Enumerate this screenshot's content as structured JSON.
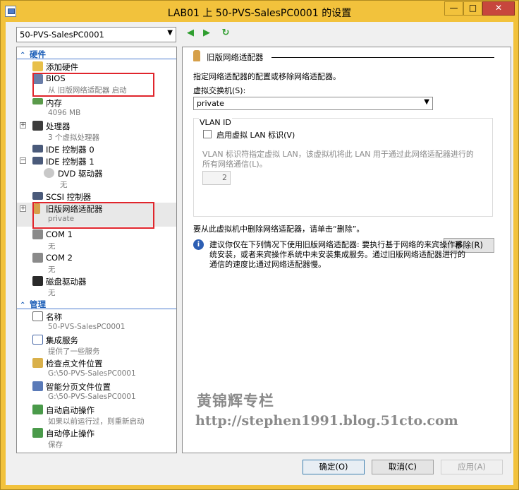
{
  "window": {
    "title": "LAB01 上 50-PVS-SalesPC0001 的设置",
    "min_glyph": "—",
    "max_glyph": "□",
    "close_glyph": "✕"
  },
  "vm_selector": {
    "value": "50-PVS-SalesPC0001"
  },
  "tree": {
    "hardware_header": "硬件",
    "management_header": "管理",
    "hardware_items": [
      {
        "label": "添加硬件",
        "sub": "",
        "icon": "add-hardware-icon"
      },
      {
        "label": "BIOS",
        "sub": "从 旧版网络适配器 启动",
        "icon": "bios-icon"
      },
      {
        "label": "内存",
        "sub": "4096 MB",
        "icon": "memory-icon"
      },
      {
        "label": "处理器",
        "sub": "3 个虚拟处理器",
        "icon": "processor-icon"
      },
      {
        "label": "IDE 控制器 0",
        "sub": "",
        "icon": "ide-controller-icon"
      },
      {
        "label": "IDE 控制器 1",
        "sub": "",
        "icon": "ide-controller-icon"
      },
      {
        "label": "DVD 驱动器",
        "sub": "无",
        "icon": "dvd-drive-icon"
      },
      {
        "label": "SCSI 控制器",
        "sub": "",
        "icon": "scsi-controller-icon"
      },
      {
        "label": "旧版网络适配器",
        "sub": "private",
        "icon": "network-adapter-icon"
      },
      {
        "label": "COM 1",
        "sub": "无",
        "icon": "com-port-icon"
      },
      {
        "label": "COM 2",
        "sub": "无",
        "icon": "com-port-icon"
      },
      {
        "label": "磁盘驱动器",
        "sub": "无",
        "icon": "floppy-drive-icon"
      }
    ],
    "management_items": [
      {
        "label": "名称",
        "sub": "50-PVS-SalesPC0001",
        "icon": "name-icon"
      },
      {
        "label": "集成服务",
        "sub": "提供了一些服务",
        "icon": "integration-services-icon"
      },
      {
        "label": "检查点文件位置",
        "sub": "G:\\50-PVS-SalesPC0001",
        "icon": "checkpoint-icon"
      },
      {
        "label": "智能分页文件位置",
        "sub": "G:\\50-PVS-SalesPC0001",
        "icon": "paging-file-icon"
      },
      {
        "label": "自动启动操作",
        "sub": "如果以前运行过，则重新启动",
        "icon": "auto-start-icon"
      },
      {
        "label": "自动停止操作",
        "sub": "保存",
        "icon": "auto-stop-icon"
      }
    ]
  },
  "detail": {
    "title": "旧版网络适配器",
    "description": "指定网络适配器的配置或移除网络适配器。",
    "switch_label": "虚拟交换机(S):",
    "switch_value": "private",
    "vlan_legend": "VLAN ID",
    "vlan_checkbox_label": "启用虚拟 LAN 标识(V)",
    "vlan_checked": false,
    "vlan_help_line1": "VLAN 标识符指定虚拟 LAN，该虚拟机将此 LAN 用于通过此网络适配器进行的",
    "vlan_help_line2": "所有网络通信(L)。",
    "vlan_value": "2",
    "remove_prompt": "要从此虚拟机中删除网络适配器，请单击“删除”。",
    "remove_button": "移除(R)",
    "info_line1": "建议你仅在下列情况下使用旧版网络适配器: 要执行基于网络的来宾操作系",
    "info_line2": "统安装，或者来宾操作系统中未安装集成服务。通过旧版网络适配器进行的",
    "info_line3": "通信的速度比通过网络适配器慢。",
    "watermark_name": "黄锦辉专栏",
    "watermark_url": "http://stephen1991.blog.51cto.com"
  },
  "footer": {
    "ok": "确定(O)",
    "cancel": "取消(C)",
    "apply": "应用(A)"
  },
  "colors": {
    "titlebar": "#f2c23c",
    "close": "#c7463d",
    "section_header": "#1d5fb8",
    "highlight_box": "#e0252c"
  }
}
